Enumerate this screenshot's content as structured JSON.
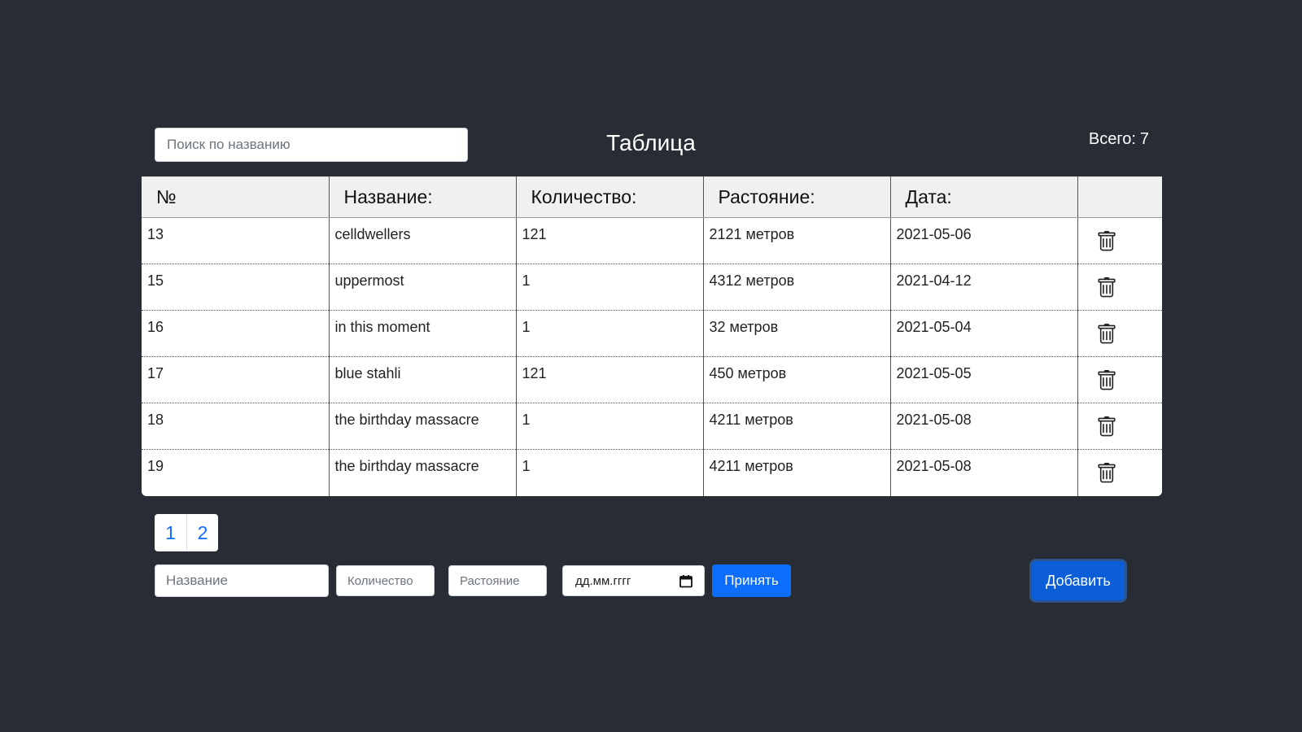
{
  "header": {
    "search_placeholder": "Поиск по названию",
    "title": "Таблица",
    "total_label": "Всего:",
    "total_count": "7"
  },
  "table": {
    "columns": [
      "№",
      "Название:",
      "Количество:",
      "Растояние:",
      "Дата:",
      ""
    ],
    "rows": [
      {
        "id": "13",
        "name": "celldwellers",
        "qty": "121",
        "distance": "2121 метров",
        "date": "2021-05-06"
      },
      {
        "id": "15",
        "name": "uppermost",
        "qty": "1",
        "distance": "4312 метров",
        "date": "2021-04-12"
      },
      {
        "id": "16",
        "name": "in this moment",
        "qty": "1",
        "distance": "32 метров",
        "date": "2021-05-04"
      },
      {
        "id": "17",
        "name": "blue stahli",
        "qty": "121",
        "distance": "450 метров",
        "date": "2021-05-05"
      },
      {
        "id": "18",
        "name": "the birthday massacre",
        "qty": "1",
        "distance": "4211 метров",
        "date": "2021-05-08"
      },
      {
        "id": "19",
        "name": "the birthday massacre",
        "qty": "1",
        "distance": "4211 метров",
        "date": "2021-05-08"
      }
    ],
    "row_action_icon": "trash-icon"
  },
  "pagination": {
    "pages": [
      "1",
      "2"
    ]
  },
  "form": {
    "name_placeholder": "Название",
    "qty_placeholder": "Количество",
    "distance_placeholder": "Растояние",
    "date_placeholder": "дд.мм.гггг",
    "date_icon": "calendar-icon",
    "accept_label": "Принять"
  },
  "add_button_label": "Добавить",
  "colors": {
    "background": "#282c34",
    "primary": "#0d6efd",
    "header_row": "#f0f0f0"
  }
}
